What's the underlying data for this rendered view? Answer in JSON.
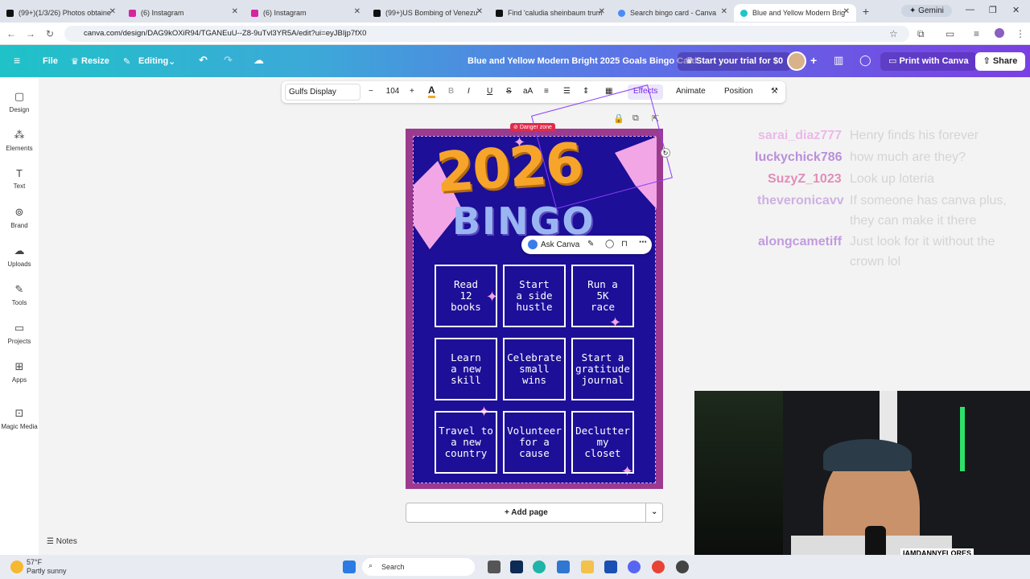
{
  "browser": {
    "tabs": [
      {
        "label": "(99+)(1/3/26) Photos obtaine",
        "icon": "tiktok-icon"
      },
      {
        "label": "(6) Instagram",
        "icon": "instagram-icon"
      },
      {
        "label": "(6) Instagram",
        "icon": "instagram-icon"
      },
      {
        "label": "(99+)US Bombing of Venezu",
        "icon": "tiktok-icon"
      },
      {
        "label": "Find 'caludia sheinbaum trum",
        "icon": "tiktok-icon"
      },
      {
        "label": "Search bingo card - Canva",
        "icon": "chrome-icon"
      },
      {
        "label": "Blue and Yellow Modern Brig",
        "icon": "canva-icon"
      }
    ],
    "gemini_label": "Gemini",
    "url": "canva.com/design/DAG9kOXiR94/TGANEuU--Z8-9uTvl3YR5A/edit?ui=eyJBIjp7fX0"
  },
  "canva_header": {
    "file": "File",
    "resize": "Resize",
    "editing": "Editing",
    "doc_title": "Blue and Yellow Modern Bright 2025 Goals Bingo Card",
    "trial": "Start your trial for $0",
    "print": "Print with Canva",
    "share": "Share"
  },
  "sidebar": {
    "items": [
      {
        "label": "Design",
        "icon": "design-icon"
      },
      {
        "label": "Elements",
        "icon": "elements-icon"
      },
      {
        "label": "Text",
        "icon": "text-icon"
      },
      {
        "label": "Brand",
        "icon": "brand-icon"
      },
      {
        "label": "Uploads",
        "icon": "upload-icon"
      },
      {
        "label": "Tools",
        "icon": "tools-icon"
      },
      {
        "label": "Projects",
        "icon": "folder-icon"
      },
      {
        "label": "Apps",
        "icon": "apps-icon"
      },
      {
        "label": "Magic Media",
        "icon": "magic-media-icon"
      }
    ],
    "notes": "Notes"
  },
  "toolbar": {
    "font": "Gulfs Display",
    "size": "104",
    "effects": "Effects",
    "animate": "Animate",
    "position": "Position"
  },
  "design": {
    "year": "2026",
    "bingo": "BINGO",
    "danger": "Danger zone",
    "ask_canva": "Ask Canva",
    "cells": [
      "Read\n12\nbooks",
      "Start\na side\nhustle",
      "Run a\n5K\nrace",
      "Learn\na new\nskill",
      "Celebrate\nsmall\nwins",
      "Start a\ngratitude\njournal",
      "Travel to\na new\ncountry",
      "Volunteer\nfor a\ncause",
      "Declutter\nmy\ncloset"
    ],
    "add_page": "+ Add page"
  },
  "chat": [
    {
      "name": "sarai_diaz777",
      "msg": "Henry finds his forever",
      "color": "#e48be0"
    },
    {
      "name": "luckychick786",
      "msg": "how much are they?",
      "color": "#8a3fc4"
    },
    {
      "name": "SuzyZ_1023",
      "msg": "Look up loteria",
      "color": "#d23a8a"
    },
    {
      "name": "theveronicavv",
      "msg": "If someone has canva plus,",
      "msg2": "they can make it there",
      "color": "#b07ad8"
    },
    {
      "name": "alongcametiff",
      "msg": "Just look for it without the",
      "msg2": "crown lol",
      "color": "#9a55d0"
    }
  ],
  "stream": {
    "handle": "IAMDANNYFLORES"
  },
  "taskbar": {
    "temp": "57°F",
    "weather": "Partly sunny",
    "search": "Search"
  }
}
